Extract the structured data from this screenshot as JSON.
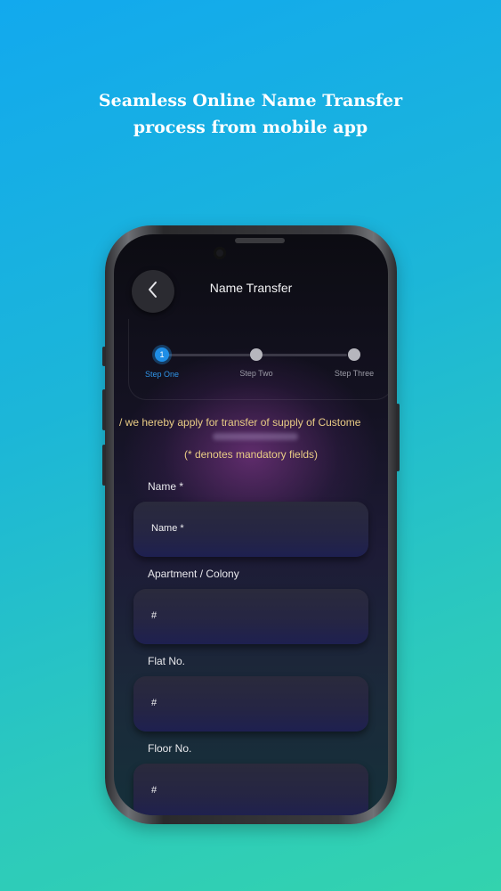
{
  "headline": {
    "line1": "Seamless Online Name Transfer",
    "line2": "process from mobile app"
  },
  "header": {
    "title": "Name Transfer",
    "back_icon": "chevron-left-icon"
  },
  "stepper": {
    "steps": [
      {
        "label": "Step One",
        "number": "1",
        "state": "active"
      },
      {
        "label": "Step Two",
        "state": "pending"
      },
      {
        "label": "Step Three",
        "state": "pending"
      }
    ],
    "active_color": "#1f8ee6"
  },
  "form": {
    "declaration": "/ we hereby apply for transfer of supply of Custome",
    "mandatory_note": "(* denotes mandatory fields)",
    "fields": [
      {
        "label": "Name *",
        "value": "Name *"
      },
      {
        "label": "Apartment / Colony",
        "value": "#"
      },
      {
        "label": "Flat No.",
        "value": "#"
      },
      {
        "label": "Floor No.",
        "value": "#"
      }
    ],
    "accent_text_color": "#e9cc85"
  }
}
